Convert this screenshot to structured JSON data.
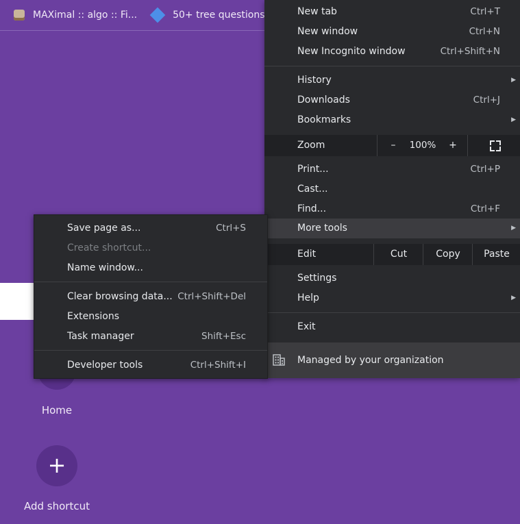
{
  "bookmarks": [
    {
      "label": "MAXimal :: algo :: Fi...",
      "icon": "maximal-favicon"
    },
    {
      "label": "50+ tree questions...",
      "icon": "diamond-favicon"
    }
  ],
  "ntp": {
    "home_label": "Home",
    "add_shortcut_label": "Add shortcut",
    "add_icon": "+"
  },
  "menu": {
    "new_tab": {
      "label": "New tab",
      "shortcut": "Ctrl+T"
    },
    "new_window": {
      "label": "New window",
      "shortcut": "Ctrl+N"
    },
    "new_incognito": {
      "label": "New Incognito window",
      "shortcut": "Ctrl+Shift+N"
    },
    "history": {
      "label": "History"
    },
    "downloads": {
      "label": "Downloads",
      "shortcut": "Ctrl+J"
    },
    "bookmarks": {
      "label": "Bookmarks"
    },
    "zoom": {
      "label": "Zoom",
      "minus": "–",
      "value": "100%",
      "plus": "+"
    },
    "print": {
      "label": "Print...",
      "shortcut": "Ctrl+P"
    },
    "cast": {
      "label": "Cast..."
    },
    "find": {
      "label": "Find...",
      "shortcut": "Ctrl+F"
    },
    "more_tools": {
      "label": "More tools"
    },
    "edit": {
      "label": "Edit",
      "cut": "Cut",
      "copy": "Copy",
      "paste": "Paste"
    },
    "settings": {
      "label": "Settings"
    },
    "help": {
      "label": "Help"
    },
    "exit": {
      "label": "Exit"
    },
    "managed": {
      "label": "Managed by your organization"
    },
    "arrow_glyph": "▶"
  },
  "submenu": {
    "save_page": {
      "label": "Save page as...",
      "shortcut": "Ctrl+S"
    },
    "create_shortcut": {
      "label": "Create shortcut..."
    },
    "name_window": {
      "label": "Name window..."
    },
    "clear_browsing": {
      "label": "Clear browsing data...",
      "shortcut": "Ctrl+Shift+Del"
    },
    "extensions": {
      "label": "Extensions"
    },
    "task_manager": {
      "label": "Task manager",
      "shortcut": "Shift+Esc"
    },
    "developer_tools": {
      "label": "Developer tools",
      "shortcut": "Ctrl+Shift+I"
    }
  },
  "colors": {
    "background": "#6b3fa0",
    "menu_bg": "#292a2d",
    "highlight": "#3c3c40"
  }
}
